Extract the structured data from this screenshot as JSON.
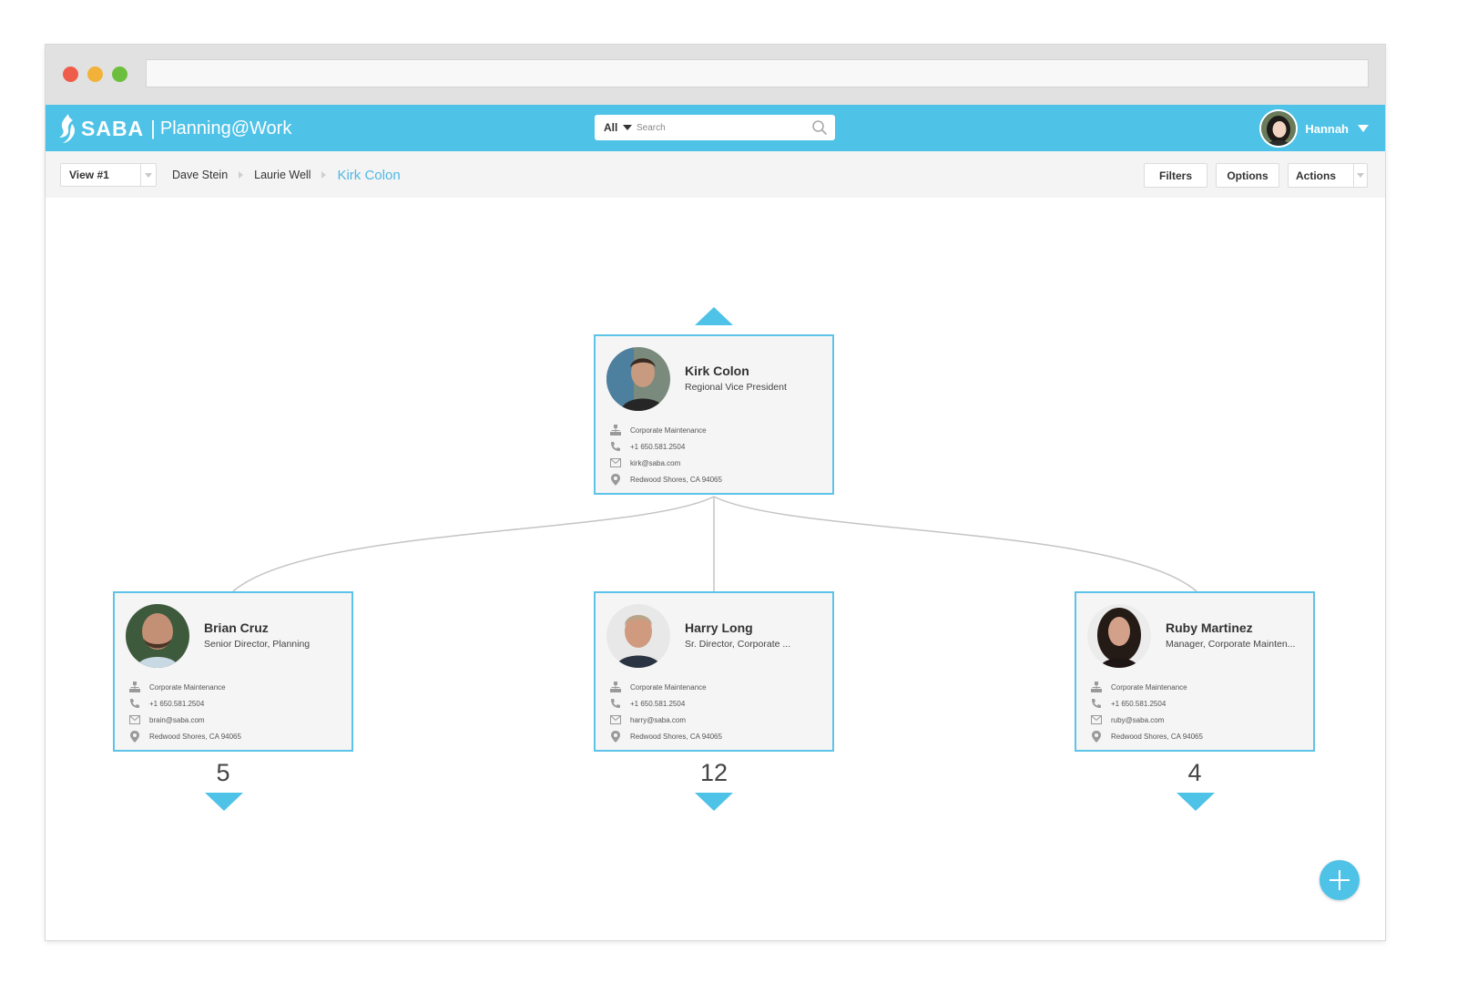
{
  "app": {
    "brand": "SABA",
    "separator": "|",
    "product": "Planning@Work"
  },
  "search": {
    "scope": "All",
    "placeholder": "Search"
  },
  "user": {
    "name": "Hannah"
  },
  "toolbar": {
    "view_label": "View #1",
    "breadcrumb": [
      "Dave Stein",
      "Laurie Well"
    ],
    "current": "Kirk Colon",
    "filters_label": "Filters",
    "options_label": "Options",
    "actions_label": "Actions"
  },
  "root": {
    "name": "Kirk Colon",
    "title": "Regional Vice President",
    "department": "Corporate Maintenance",
    "phone": "+1 650.581.2504",
    "email": "kirk@saba.com",
    "location": "Redwood Shores, CA 94065"
  },
  "reports": [
    {
      "name": "Brian Cruz",
      "title": "Senior Director, Planning",
      "department": "Corporate Maintenance",
      "phone": "+1 650.581.2504",
      "email": "brain@saba.com",
      "location": "Redwood Shores, CA 94065",
      "count": "5"
    },
    {
      "name": "Harry Long",
      "title": "Sr. Director, Corporate ...",
      "department": "Corporate Maintenance",
      "phone": "+1 650.581.2504",
      "email": "harry@saba.com",
      "location": "Redwood Shores, CA 94065",
      "count": "12"
    },
    {
      "name": "Ruby Martinez",
      "title": "Manager, Corporate Mainten...",
      "department": "Corporate Maintenance",
      "phone": "+1 650.581.2504",
      "email": "ruby@saba.com",
      "location": "Redwood Shores, CA 94065",
      "count": "4"
    }
  ],
  "colors": {
    "accent": "#4fc2e7",
    "card_border": "#5dc3e8",
    "card_bg": "#f5f5f5",
    "breadcrumb_current": "#4fb9e3"
  },
  "icons": {
    "department": "org-chart-icon",
    "phone": "phone-icon",
    "email": "envelope-icon",
    "location": "map-pin-icon",
    "add": "plus-icon"
  }
}
